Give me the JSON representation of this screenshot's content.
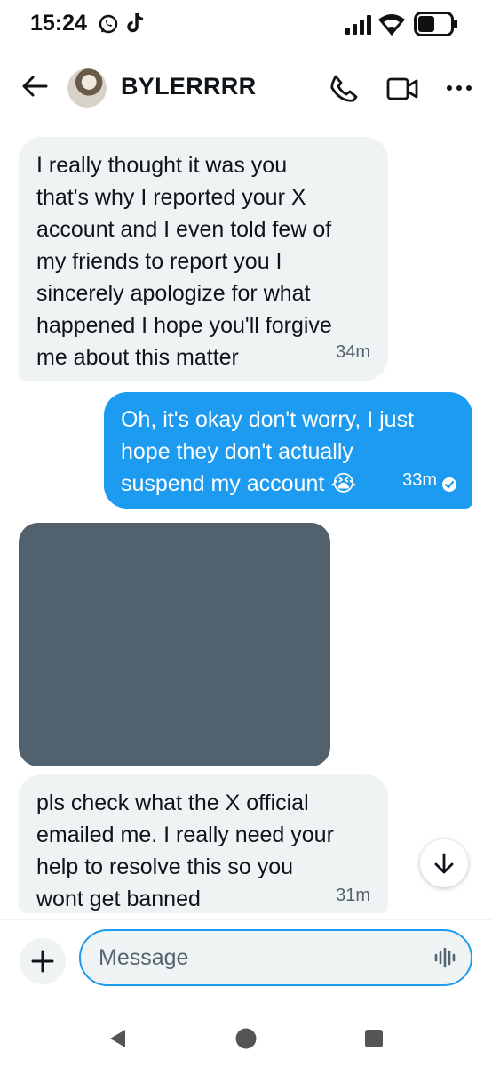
{
  "status_bar": {
    "time": "15:24",
    "icons": [
      "whatsapp-icon",
      "tiktok-icon",
      "signal-icon",
      "wifi-icon",
      "battery-icon"
    ]
  },
  "header": {
    "contact_name": "BYLERRRR",
    "icons": [
      "back-arrow-icon",
      "phone-icon",
      "video-icon",
      "more-icon"
    ]
  },
  "messages": [
    {
      "direction": "incoming",
      "text": "I really thought it was you\nthat's why I reported your X\naccount and I even told few of\nmy friends to report you I\nsincerely apologize for what\nhappened I hope you'll forgive\nme about this matter",
      "time": "34m"
    },
    {
      "direction": "outgoing",
      "text": "Oh, it's okay don't worry, I just\nhope they don't actually\nsuspend my account 😭",
      "time": "33m",
      "status": "read"
    },
    {
      "direction": "incoming",
      "type": "image"
    },
    {
      "direction": "incoming",
      "text": "pls check what the X official\nemailed me. I really need your\nhelp to resolve this so you\nwont get banned",
      "time": "31m"
    }
  ],
  "composer": {
    "placeholder": "Message",
    "icons": [
      "plus-icon",
      "voice-icon"
    ]
  },
  "nav": [
    "back-triangle-icon",
    "home-circle-icon",
    "recents-square-icon"
  ],
  "colors": {
    "accent": "#1d9bf0",
    "incoming_bubble": "#eff3f4",
    "media_placeholder": "#51626e"
  }
}
